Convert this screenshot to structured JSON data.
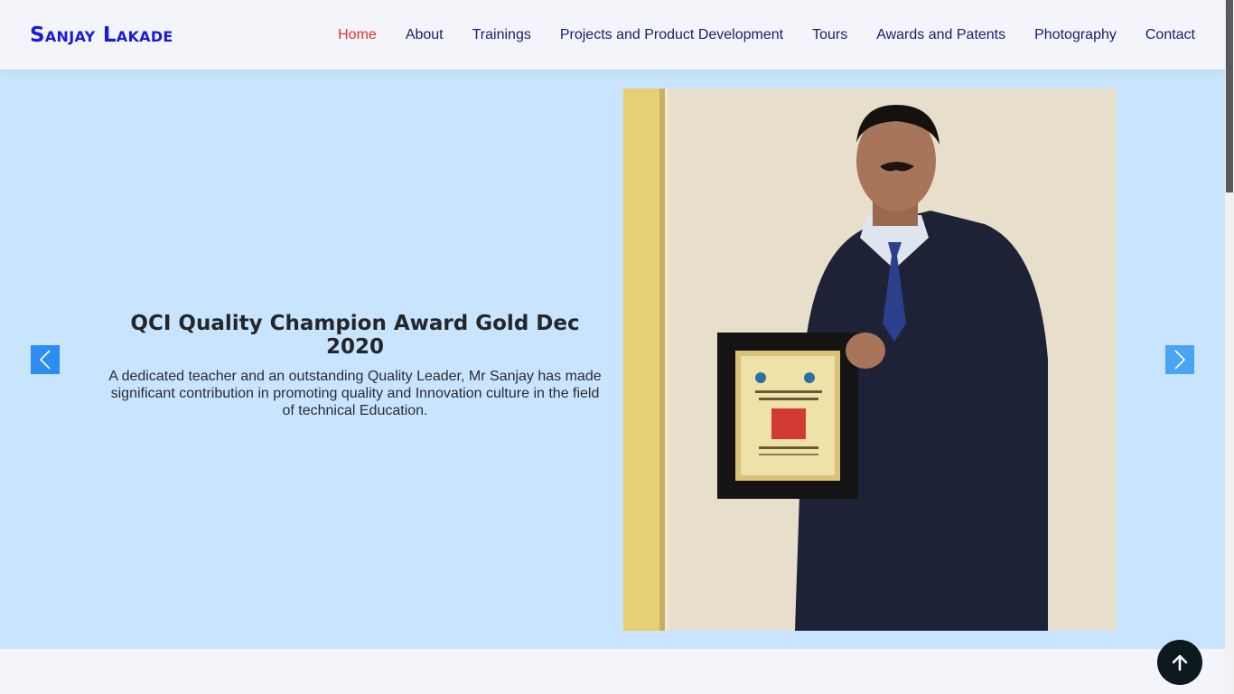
{
  "header": {
    "logo": "Sanjay Lakade",
    "nav": [
      {
        "label": "Home",
        "active": true
      },
      {
        "label": "About"
      },
      {
        "label": "Trainings"
      },
      {
        "label": "Projects and Product Development"
      },
      {
        "label": "Tours"
      },
      {
        "label": "Awards and Patents"
      },
      {
        "label": "Photography"
      },
      {
        "label": "Contact"
      }
    ]
  },
  "hero": {
    "title": "QCI Quality Champion Award Gold Dec 2020",
    "text": "A dedicated teacher and an outstanding Quality Leader, Mr Sanjay has made significant contribution in promoting quality and Innovation culture in the field of technical Education.",
    "prev_icon": "chevron-left-icon",
    "next_icon": "chevron-right-icon"
  },
  "back_to_top_icon": "arrow-up-icon",
  "colors": {
    "logo": "#1a1adc",
    "nav": "#1c1c6c",
    "nav_active": "#e8312b",
    "hero_bg": "#c8e4fe",
    "arrow_bg": "#2d8df3",
    "back_top_bg": "#0c1a1e"
  }
}
